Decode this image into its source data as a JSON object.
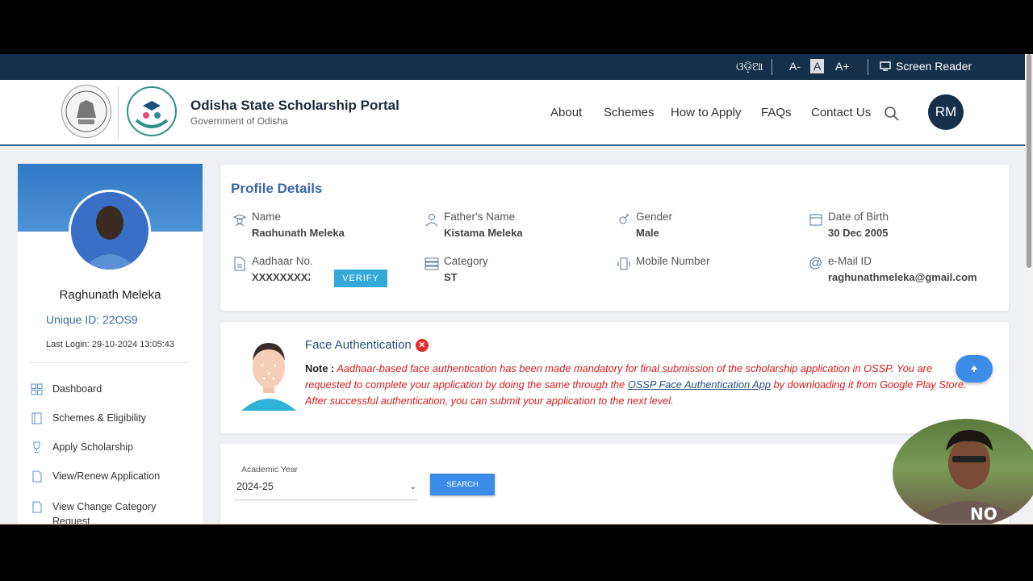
{
  "topbar": {
    "odia_label": "ଓଡ଼ିଆ",
    "font_decrease": "A-",
    "font_normal": "A",
    "font_increase": "A+",
    "screen_reader": "Screen Reader"
  },
  "header": {
    "title": "Odisha State Scholarship Portal",
    "subtitle": "Government of Odisha",
    "nav": [
      "About",
      "Schemes",
      "How to Apply",
      "FAQs",
      "Contact Us"
    ],
    "avatar_initials": "RM"
  },
  "sidebar": {
    "name": "Raghunath Meleka",
    "unique_id": "Unique ID: 22OS9",
    "last_login": "Last Login: 29-10-2024 13:05:43",
    "menu": [
      "Dashboard",
      "Schemes & Eligibility",
      "Apply Scholarship",
      "View/Renew Application",
      "View Change Category Request"
    ]
  },
  "profile": {
    "title": "Profile Details",
    "name_label": "Name",
    "name_value": "Raghunath Meleka",
    "father_label": "Father's Name",
    "father_value": "Kistama Meleka",
    "gender_label": "Gender",
    "gender_value": "Male",
    "dob_label": "Date of Birth",
    "dob_value": "30 Dec 2005",
    "aadhaar_label": "Aadhaar No.",
    "aadhaar_value": "XXXXXXXXX",
    "verify_label": "VERIFY",
    "category_label": "Category",
    "category_value": "ST",
    "mobile_label": "Mobile Number",
    "mobile_value": "",
    "email_label": "e-Mail ID",
    "email_value": "raghunathmeleka@gmail.com"
  },
  "face_auth": {
    "title": "Face Authentication",
    "note_label": "Note :",
    "note_text_1": " Aadhaar-based face authentication has been made mandatory for final submission of the scholarship application in OSSP. You are requested to complete your application by doing the same through the ",
    "app_link": "OSSP Face Authentication App",
    "note_text_2": " by downloading it from Google Play Store. After successful authentication, you can submit your application to the next level."
  },
  "academic": {
    "label": "Academic Year",
    "selected": "2024-25",
    "search_label": "SEARCH"
  },
  "webcam": {
    "shirt_text": "NO"
  },
  "colors": {
    "navy": "#16304a",
    "accent_blue": "#3d8ce8",
    "link_blue": "#3a67a8",
    "alert_red": "#d41c1c"
  }
}
